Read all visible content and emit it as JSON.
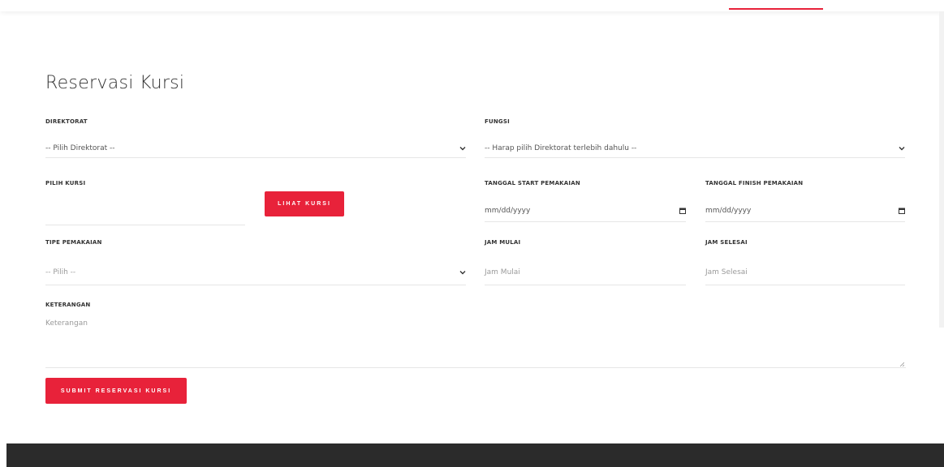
{
  "page": {
    "title": "Reservasi Kursi"
  },
  "colors": {
    "accent": "#e8223a",
    "footer": "#2b2b2b"
  },
  "form": {
    "direktorat": {
      "label": "DIREKTORAT",
      "value": "-- Pilih Direktorat --"
    },
    "fungsi": {
      "label": "FUNGSI",
      "value": "-- Harap pilih Direktorat terlebih dahulu --"
    },
    "pilih_kursi": {
      "label": "PILIH KURSI",
      "button": "LIHAT KURSI"
    },
    "tanggal_start": {
      "label": "TANGGAL START PEMAKAIAN",
      "placeholder": "mm/dd/yyyy"
    },
    "tanggal_finish": {
      "label": "TANGGAL FINISH PEMAKAIAN",
      "placeholder": "mm/dd/yyyy"
    },
    "tipe_pemakaian": {
      "label": "TIPE PEMAKAIAN",
      "value": "-- Pilih --"
    },
    "jam_mulai": {
      "label": "JAM MULAI",
      "placeholder": "Jam Mulai"
    },
    "jam_selesai": {
      "label": "JAM SELESAI",
      "placeholder": "Jam Selesai"
    },
    "keterangan": {
      "label": "KETERANGAN",
      "placeholder": "Keterangan"
    },
    "submit": "SUBMIT RESERVASI KURSI"
  },
  "icons": [
    "chevron-down-icon",
    "calendar-icon",
    "resize-handle-icon"
  ]
}
